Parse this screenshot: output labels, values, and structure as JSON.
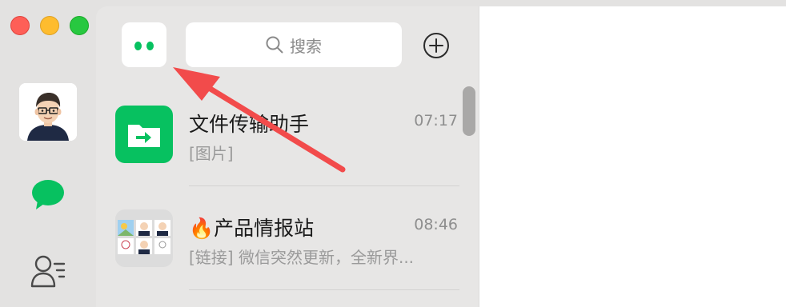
{
  "window": {
    "controls": [
      "close",
      "minimize",
      "maximize"
    ]
  },
  "rail": {
    "avatar_icon": "user-avatar",
    "items": [
      {
        "icon": "chat-bubble-icon",
        "active": true
      },
      {
        "icon": "contacts-icon",
        "active": false
      }
    ]
  },
  "header": {
    "mini_program_icon": "mini-program-icon",
    "search": {
      "placeholder": "搜索",
      "icon": "search-icon"
    },
    "add_icon": "plus-circle-icon"
  },
  "chats": [
    {
      "name": "文件传输助手",
      "time": "07:17",
      "preview": "[图片]",
      "icon": "file-transfer-icon"
    },
    {
      "name": "🔥产品情报站",
      "time": "08:46",
      "preview": "[链接] 微信突然更新，全新界...",
      "icon": "group-avatar-grid"
    }
  ],
  "colors": {
    "accent": "#07c160",
    "annotation_arrow": "#f24b4b"
  }
}
